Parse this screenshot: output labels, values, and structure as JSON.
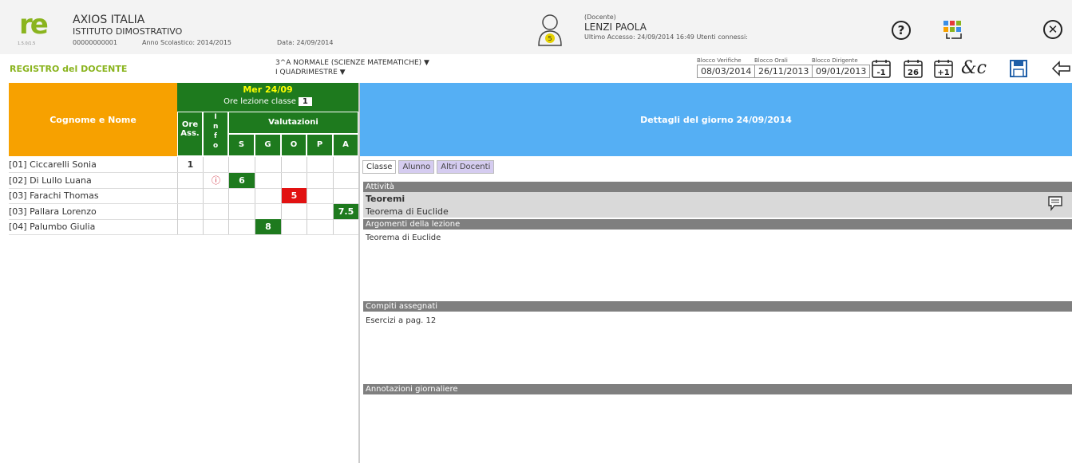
{
  "header": {
    "logo_text": "re",
    "logo_version": "1.5.0/1.5",
    "org_name": "AXIOS ITALIA",
    "school_name": "ISTITUTO DIMOSTRATIVO",
    "school_code": "00000000001",
    "school_year": "Anno Scolastico: 2014/2015",
    "date": "Data: 24/09/2014",
    "user_role": "(Docente)",
    "user_name": "LENZI PAOLA",
    "user_access": "Ultimo Accesso: 24/09/2014 16:49 Utenti connessi:",
    "help_icon": "question-circle-icon",
    "apps_icon": "grid-apps-icon",
    "close_icon": "close-circle-icon"
  },
  "toolbar": {
    "register_label": "REGISTRO del DOCENTE",
    "class_select": "3^A NORMALE (SCIENZE MATEMATICHE)",
    "period_select": "I QUADRIMESTRE",
    "blocks": [
      {
        "label": "Blocco Verifiche",
        "value": "08/03/2014"
      },
      {
        "label": "Blocco Orali",
        "value": "26/11/2013"
      },
      {
        "label": "Blocco Dirigente",
        "value": "09/01/2013"
      }
    ],
    "cal_prev": "-1",
    "cal_today": "26",
    "cal_next": "+1",
    "signature_icon": "signature-icon",
    "save_icon": "save-icon",
    "back_icon": "back-arrow-icon"
  },
  "grid": {
    "name_header": "Cognome e Nome",
    "date_header": "Mer 24/09",
    "ore_lezione_label": "Ore lezione classe",
    "ore_lezione_value": "1",
    "ore_ass_line1": "Ore",
    "ore_ass_line2": "Ass.",
    "info_label": "Info",
    "valutazioni_label": "Valutazioni",
    "val_cols": [
      "S",
      "G",
      "O",
      "P",
      "A"
    ],
    "rows": [
      {
        "name": "[01] Ciccarelli Sonia",
        "ore": "1",
        "info": "",
        "S": "",
        "G": "",
        "O": "",
        "P": "",
        "A": ""
      },
      {
        "name": "[02] Di Lullo Luana",
        "ore": "",
        "info": "ⓘ",
        "S": "6",
        "G": "",
        "O": "",
        "P": "",
        "A": ""
      },
      {
        "name": "[03] Farachi Thomas",
        "ore": "",
        "info": "",
        "S": "",
        "G": "",
        "O": "5",
        "P": "",
        "A": ""
      },
      {
        "name": "[03] Pallara Lorenzo",
        "ore": "",
        "info": "",
        "S": "",
        "G": "",
        "O": "",
        "P": "",
        "A": "7.5"
      },
      {
        "name": "[04] Palumbo Giulia",
        "ore": "",
        "info": "",
        "S": "",
        "G": "8",
        "O": "",
        "P": "",
        "A": ""
      }
    ]
  },
  "detail": {
    "title": "Dettagli del giorno 24/09/2014",
    "tabs": [
      {
        "label": "Classe",
        "active": true
      },
      {
        "label": "Alunno",
        "active": false
      },
      {
        "label": "Altri Docenti",
        "active": false
      }
    ],
    "attivita_label": "Attività",
    "attivita_title": "Teoremi",
    "attivita_sub": "Teorema di Euclide",
    "argomenti_label": "Argomenti della lezione",
    "argomenti_text": "Teorema di Euclide",
    "compiti_label": "Compiti assegnati",
    "compiti_text": "Esercizi a pag. 12",
    "annotazioni_label": "Annotazioni giornaliere",
    "annotazioni_text": ""
  },
  "colors": {
    "orange": "#f7a100",
    "green": "#1e7a1e",
    "blue": "#55aff4",
    "red": "#e21212",
    "lime": "#8ab41e"
  }
}
